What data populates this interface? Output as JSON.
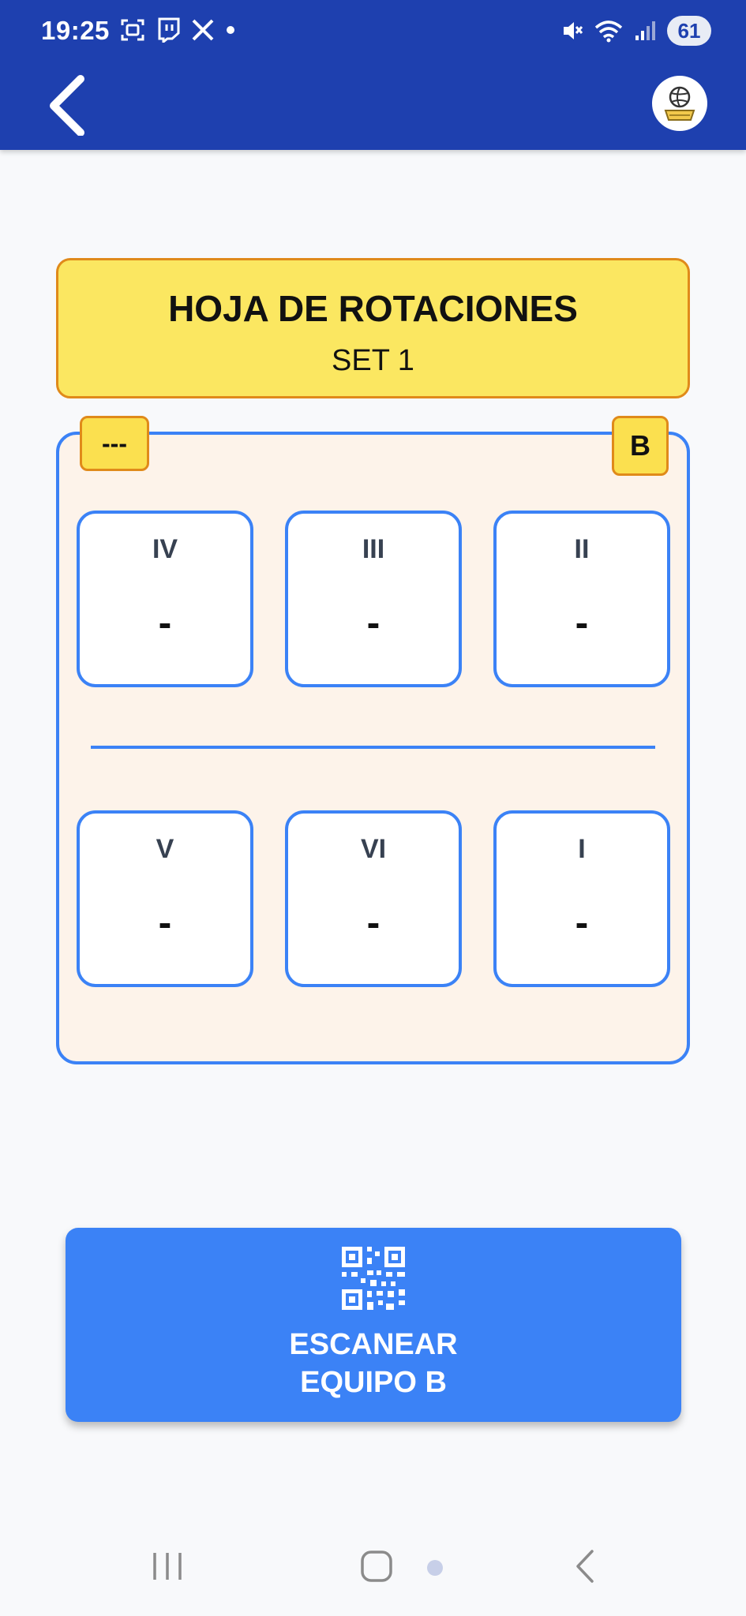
{
  "status_bar": {
    "time": "19:25",
    "battery": "61",
    "icons_left": [
      "screenshot-icon",
      "twitch-icon",
      "x-icon",
      "dot-icon"
    ],
    "icons_right": [
      "mute-icon",
      "wifi-icon",
      "signal-icon",
      "battery-icon"
    ]
  },
  "header": {
    "back_icon": "chevron-left-icon",
    "logo_icon": "volleyball-logo-icon"
  },
  "sheet": {
    "title": "HOJA DE ROTACIONES",
    "set_label": "SET 1"
  },
  "court": {
    "left_tag": "---",
    "team_tag": "B",
    "front_row": [
      {
        "numeral": "IV",
        "player": "-"
      },
      {
        "numeral": "III",
        "player": "-"
      },
      {
        "numeral": "II",
        "player": "-"
      }
    ],
    "back_row": [
      {
        "numeral": "V",
        "player": "-"
      },
      {
        "numeral": "VI",
        "player": "-"
      },
      {
        "numeral": "I",
        "player": "-"
      }
    ]
  },
  "scan_button": {
    "icon": "qr-code-icon",
    "label": "ESCANEAR\nEQUIPO B"
  },
  "colors": {
    "header": "#1e40af",
    "accent": "#3b82f6",
    "title_bg": "#fbe761",
    "title_border": "#e08a1a",
    "court_bg": "#fdf3ea"
  },
  "nav_bar": {
    "items": [
      "recents-icon",
      "home-icon",
      "back-icon"
    ]
  }
}
